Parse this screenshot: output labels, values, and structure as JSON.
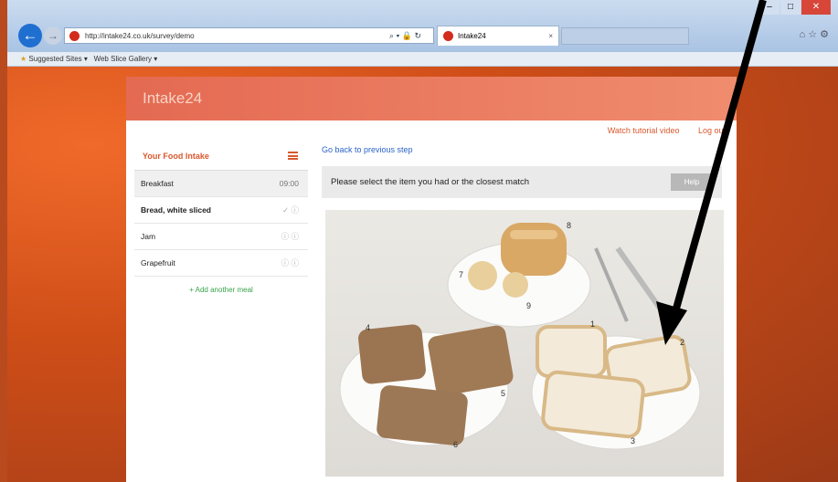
{
  "browser": {
    "address": "http://intake24.co.uk/survey/demo",
    "tab_title": "Intake24",
    "tab2_title": "",
    "favorites": [
      "Suggested Sites",
      "Web Slice Gallery"
    ]
  },
  "app": {
    "logo": "Intake24",
    "top_links": [
      "Watch tutorial video",
      "Log out"
    ]
  },
  "sidebar": {
    "title": "Your Food Intake",
    "rows": [
      {
        "label": "Breakfast",
        "right": "09:00",
        "kind": "meal"
      },
      {
        "label": "Bread, white sliced",
        "right": "✓ ⓘ",
        "kind": "food"
      },
      {
        "label": "Jam",
        "right": "ⓘ ⓘ",
        "kind": "food"
      },
      {
        "label": "Grapefruit",
        "right": "ⓘ ⓘ",
        "kind": "food"
      }
    ],
    "add_meal": "+ Add another meal"
  },
  "main": {
    "back_link": "Go back to previous step",
    "prompt": "Please select the item you had or the closest match",
    "help": "Help",
    "photo_numbers": [
      "1",
      "2",
      "3",
      "4",
      "5",
      "6",
      "7",
      "8",
      "9"
    ]
  },
  "colors": {
    "accent": "#d9582e",
    "header": "#e46a52",
    "link": "#2b63c9"
  }
}
